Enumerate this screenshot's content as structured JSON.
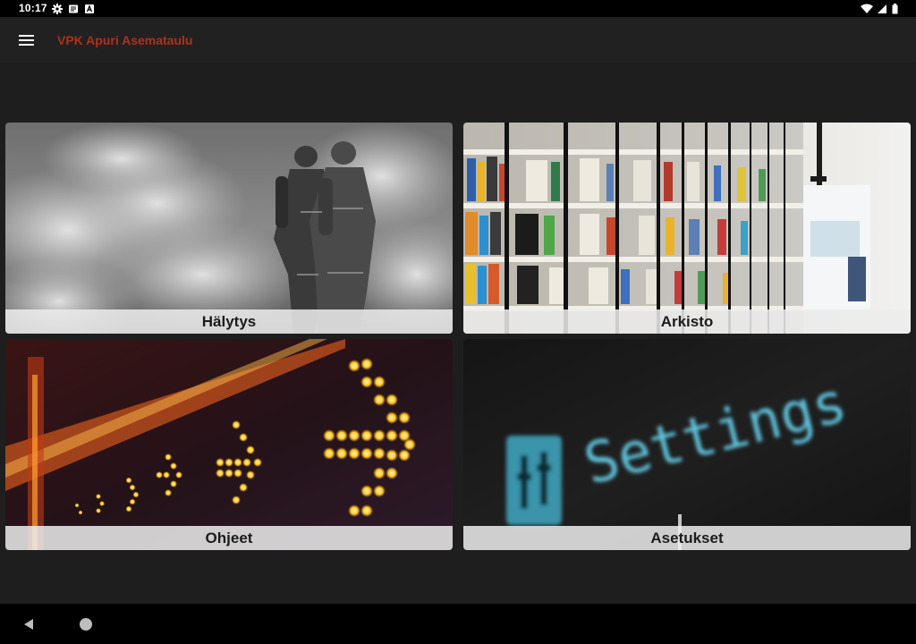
{
  "status_bar": {
    "time": "10:17",
    "left_icons": [
      "gear-icon",
      "notes-icon",
      "font-a-icon"
    ],
    "right_icons": [
      "wifi-icon",
      "cell-signal-icon",
      "battery-icon"
    ]
  },
  "app_bar": {
    "menu_icon": "hamburger-menu-icon",
    "title": "VPK Apuri Asemataulu",
    "title_color": "#b0301c"
  },
  "tiles": [
    {
      "label": "Hälytys",
      "image": "firefighters-in-smoke"
    },
    {
      "label": "Arkisto",
      "image": "library-bookshelves"
    },
    {
      "label": "Ohjeet",
      "image": "led-arrow-signs"
    },
    {
      "label": "Asetukset",
      "image": "settings-screen"
    }
  ],
  "tile_art_text": {
    "settings_word": "Settings"
  },
  "nav_bar": {
    "icons": [
      "back-triangle-icon",
      "home-circle-icon"
    ]
  }
}
